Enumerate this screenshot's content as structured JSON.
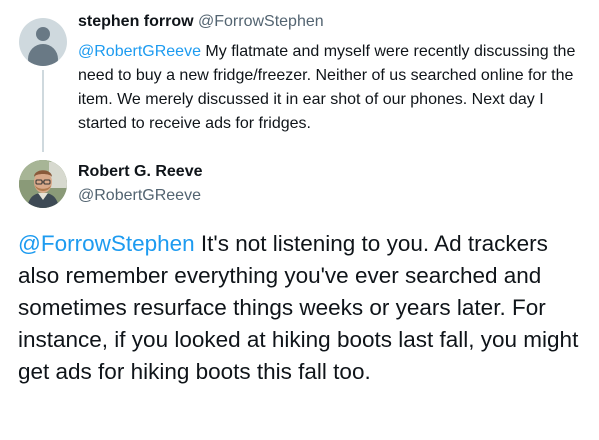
{
  "reply_tweet": {
    "author_name": "stephen forrow",
    "author_handle": "@ForrowStephen",
    "mention": "@RobertGReeve",
    "text": " My flatmate and myself were recently discussing the need to buy a new fridge/freezer. Neither of us searched online for the item. We merely discussed it in ear shot of our phones.  Next day I started to receive ads for fridges."
  },
  "main_tweet": {
    "author_name": "Robert G. Reeve",
    "author_handle": "@RobertGReeve",
    "mention": "@ForrowStephen",
    "text": " It's not listening to you. Ad trackers also remember everything you've ever searched and sometimes resurface things weeks or years later. For instance, if you looked at hiking boots last fall, you might get ads for hiking boots this fall too."
  },
  "colors": {
    "text": "#0f1419",
    "secondary": "#536471",
    "mention": "#1d9bf0",
    "thread_line": "#cfd9de",
    "default_avatar_bg": "#cfd9de",
    "default_avatar_fg": "#697985"
  },
  "icons": {
    "reply_avatar": "default-profile-icon",
    "main_avatar": "profile-photo"
  }
}
